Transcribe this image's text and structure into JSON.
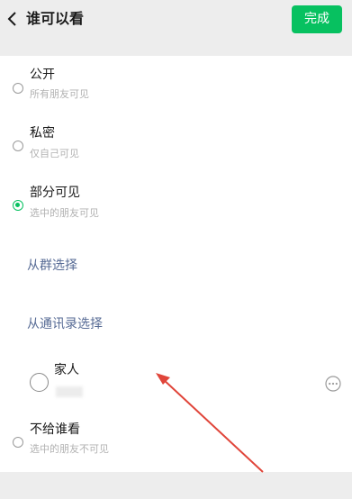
{
  "header": {
    "title": "谁可以看",
    "done_label": "完成"
  },
  "options": [
    {
      "label": "公开",
      "sub": "所有朋友可见",
      "selected": false
    },
    {
      "label": "私密",
      "sub": "仅自己可见",
      "selected": false
    },
    {
      "label": "部分可见",
      "sub": "选中的朋友可见",
      "selected": true
    },
    {
      "label": "不给谁看",
      "sub": "选中的朋友不可见",
      "selected": false
    }
  ],
  "partial": {
    "from_group": "从群选择",
    "from_contacts": "从通讯录选择",
    "tag_group": {
      "name": "家人",
      "icon": "more-icon"
    }
  },
  "colors": {
    "accent": "#07c160",
    "link": "#576b95",
    "annotation_arrow": "#e0453a"
  }
}
